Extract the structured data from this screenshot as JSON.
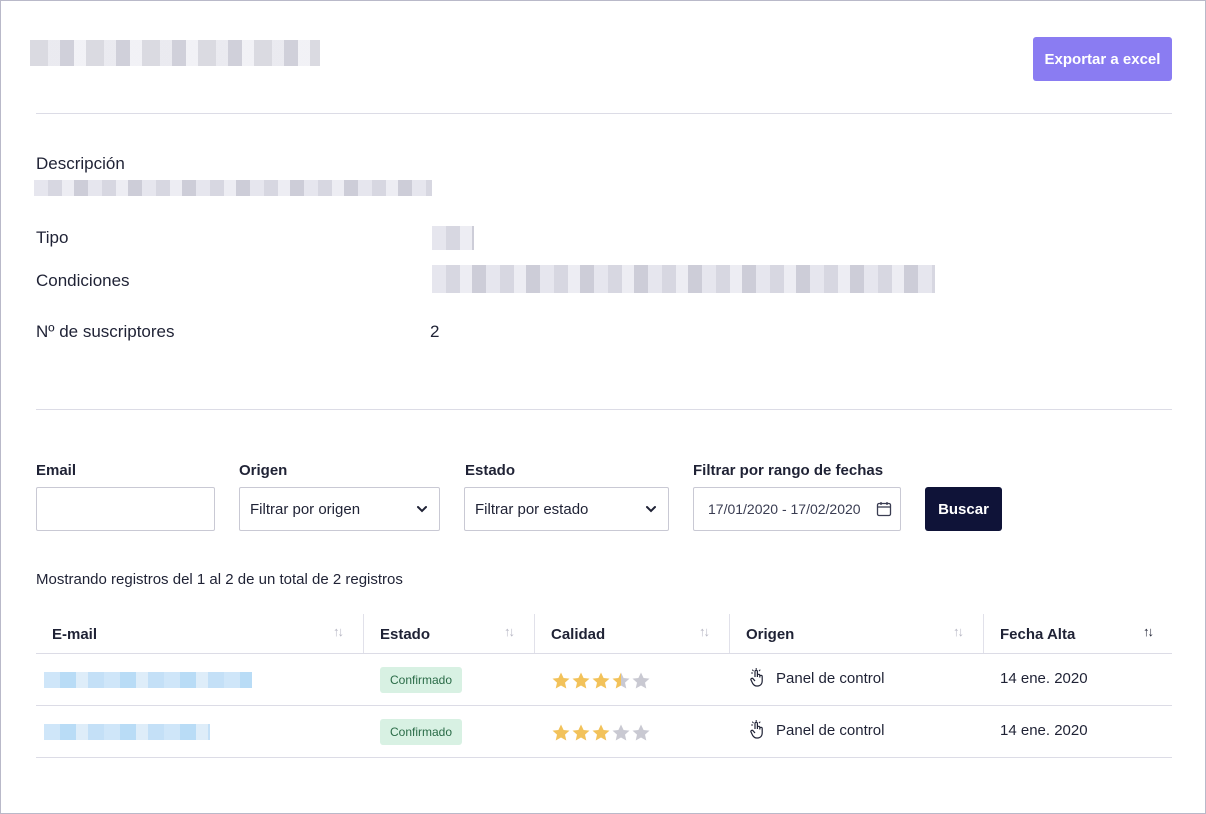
{
  "header": {
    "export_label": "Exportar a excel"
  },
  "details": {
    "descripcion_label": "Descripción",
    "tipo_label": "Tipo",
    "condiciones_label": "Condiciones",
    "suscriptores_label": "Nº de suscriptores",
    "suscriptores_value": "2"
  },
  "filters": {
    "email_label": "Email",
    "email_value": "",
    "origen_label": "Origen",
    "origen_value": "Filtrar por origen",
    "estado_label": "Estado",
    "estado_value": "Filtrar por estado",
    "fechas_label": "Filtrar por rango de fechas",
    "fechas_value": "17/01/2020 - 17/02/2020",
    "buscar_label": "Buscar"
  },
  "summary": "Mostrando registros del 1 al 2 de un total de 2 registros",
  "table": {
    "columns": [
      "E-mail",
      "Estado",
      "Calidad",
      "Origen",
      "Fecha Alta"
    ],
    "rows": [
      {
        "estado": "Confirmado",
        "calidad": 3.5,
        "origen": "Panel de control",
        "fecha": "14 ene. 2020"
      },
      {
        "estado": "Confirmado",
        "calidad": 3,
        "origen": "Panel de control",
        "fecha": "14 ene. 2020"
      }
    ]
  },
  "colors": {
    "accent": "#8a7cf2",
    "primary_dark": "#0f1338",
    "badge_bg": "#d8f1e3",
    "star_on": "#f2c25a",
    "star_off": "#c9c9d2"
  },
  "icons": {
    "sort": "sort-icon",
    "sort_active": "sort-desc-icon",
    "calendar": "calendar-icon",
    "origin": "hand-pointer-icon",
    "chevron": "chevron-down-icon"
  }
}
